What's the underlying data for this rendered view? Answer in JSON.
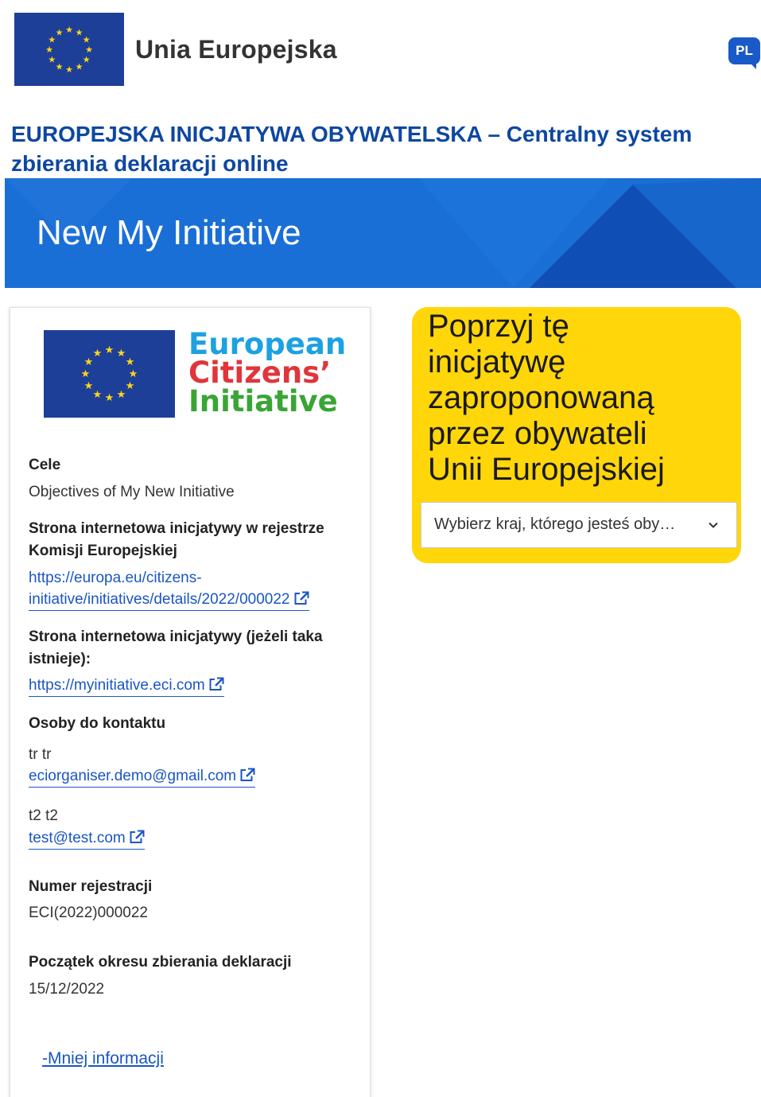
{
  "header": {
    "eu_label": "Unia Europejska",
    "language": "PL"
  },
  "site_title": "EUROPEJSKA INICJATYWA OBYWATELSKA – Centralny system zbierania deklaracji online",
  "banner": {
    "title": "New My Initiative"
  },
  "logo": {
    "line1": "European",
    "line2": "Citizens’",
    "line3": "Initiative"
  },
  "info": {
    "objectives_label": "Cele",
    "objectives_value": "Objectives of My New Initiative",
    "register_label_1": "Strona internetowa inicjatywy w rejestrze",
    "register_label_2": "Komisji Europejskiej",
    "register_link_1": "https://europa.eu/citizens-",
    "register_link_2": "initiative/initiatives/details/2022/000022",
    "website_label_1": "Strona internetowa inicjatywy (jeżeli taka",
    "website_label_2": "istnieje):",
    "website_link": "https://myinitiative.eci.com",
    "contacts_label": "Osoby do kontaktu",
    "contact1_name": "tr tr",
    "contact1_email": "eciorganiser.demo@gmail.com",
    "contact2_name": "t2 t2",
    "contact2_email": "test@test.com",
    "registration_label": "Numer rejestracji",
    "registration_value": "ECI(2022)000022",
    "start_label": "Początek okresu zbierania deklaracji",
    "start_value": "15/12/2022",
    "less_info": "-Mniej informacji"
  },
  "support": {
    "line1": "Poprzyj tę",
    "line2": "inicjatywę",
    "line3": "zaproponowaną",
    "line4": "przez obywateli",
    "line5": "Unii Europejskiej",
    "select_placeholder": "Wybierz kraj, którego jesteś oby…"
  },
  "colors": {
    "eu_blue": "#1e3f98",
    "banner_blue": "#1a6fd6",
    "title_blue": "#0e47a1",
    "link_blue": "#1a56c4",
    "support_yellow": "#ffd60a"
  }
}
